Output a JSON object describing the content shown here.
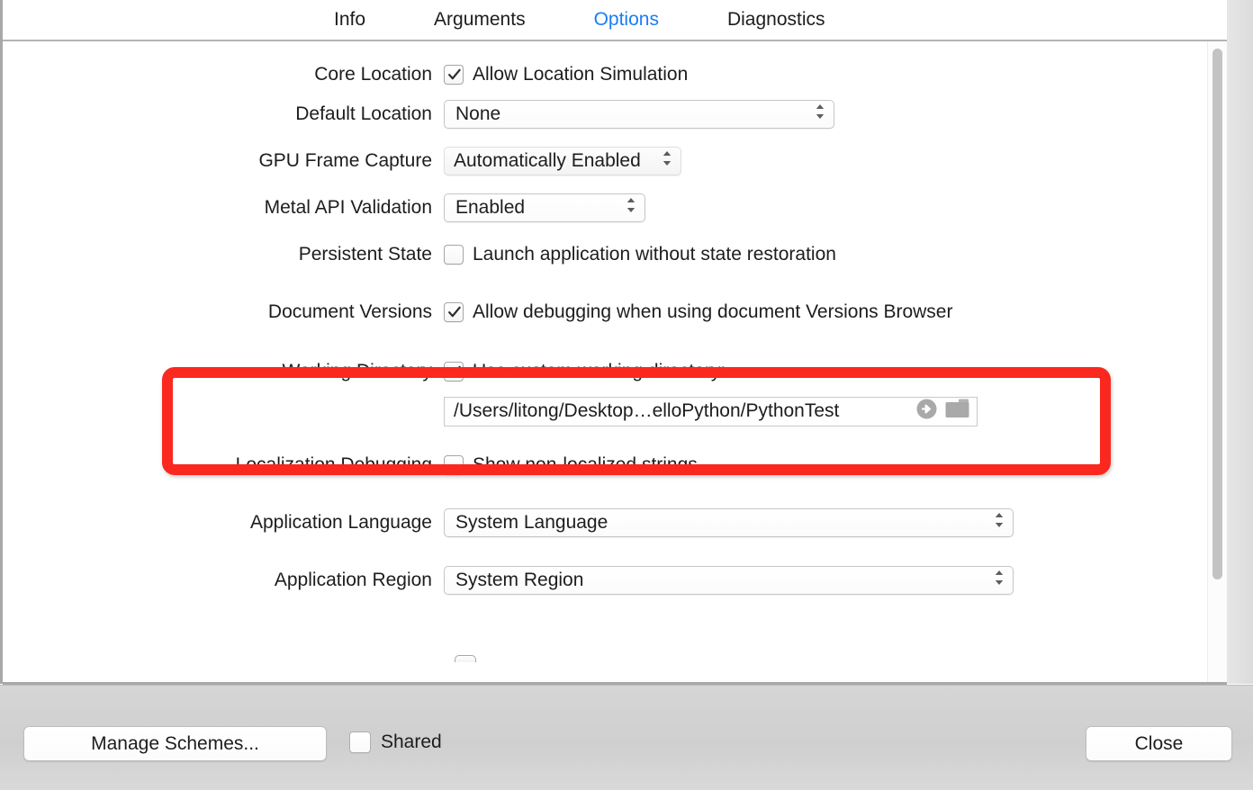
{
  "window": {
    "tabs": [
      {
        "label": "Info",
        "active": false
      },
      {
        "label": "Arguments",
        "active": false
      },
      {
        "label": "Options",
        "active": true
      },
      {
        "label": "Diagnostics",
        "active": false
      }
    ],
    "active_tab_color": "#1a7df5"
  },
  "options": {
    "core_location": {
      "label": "Core Location",
      "checkbox_label": "Allow Location Simulation",
      "checked": true
    },
    "default_location": {
      "label": "Default Location",
      "value": "None"
    },
    "gpu_frame_capture": {
      "label": "GPU Frame Capture",
      "value": "Automatically Enabled"
    },
    "metal_api_validation": {
      "label": "Metal API Validation",
      "value": "Enabled"
    },
    "persistent_state": {
      "label": "Persistent State",
      "checkbox_label": "Launch application without state restoration",
      "checked": false
    },
    "document_versions": {
      "label": "Document Versions",
      "checkbox_label": "Allow debugging when using document Versions Browser",
      "checked": true
    },
    "working_directory": {
      "label": "Working Directory",
      "checkbox_label": "Use custom working directory:",
      "checked": true,
      "path": "/Users/litong/Desktop…elloPython/PythonTest",
      "reveal_icon": "arrow-right-circle-icon",
      "folder_icon": "folder-icon",
      "highlight_color": "#fa281e"
    },
    "localization_debugging": {
      "label": "Localization Debugging",
      "checkbox_label": "Show non-localized strings",
      "checked": false
    },
    "application_language": {
      "label": "Application Language",
      "value": "System Language"
    },
    "application_region": {
      "label": "Application Region",
      "value": "System Region"
    }
  },
  "footer": {
    "manage_schemes_label": "Manage Schemes...",
    "shared_label": "Shared",
    "shared_checked": false,
    "close_label": "Close"
  }
}
